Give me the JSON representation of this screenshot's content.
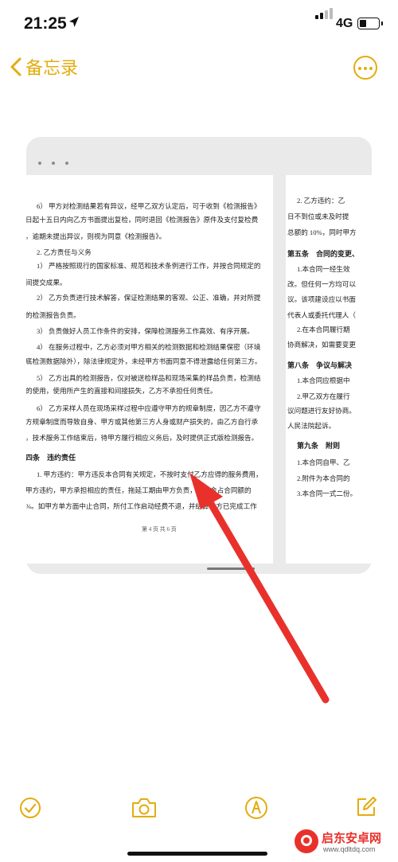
{
  "status_bar": {
    "time": "21:25",
    "network": "4G"
  },
  "nav": {
    "back_label": "备忘录"
  },
  "document": {
    "left_page_lines": [
      "6） 甲方对检测结果若有异议，经甲乙双方认定后，可于收到《检测报告》",
      "日起十五日内向乙方书面提出复检，同时退回《检测报告》原件及支付复检费",
      "。逾期未提出异议，则视为同意《检测报告》。",
      "2. 乙方责任与义务",
      "1） 严格按照现行的国家标准、规范和技术条例进行工作，并按合同规定的",
      "间提交成果。",
      "2） 乙方负责进行技术解答，保证检测结果的客观、公正、准确，并对所提",
      "的检测报告负责。",
      "3） 负责做好人员工作条件的安排，保障检测服务工作高效、有序开展。",
      "4） 在服务过程中，乙方必须对甲方相关的检测数据和检测结果保密（环境",
      "底检测数据除外），除法律规定外，未经甲方书面同意不得泄露给任何第三方。",
      "5） 乙方出具的检测报告，仅对被送检样品和现场采集的样品负责，检测结",
      "的使用，使用所产生的直接和间接损失，乙方不承担任何责任。",
      "6） 乙方采样人员在现场采样过程中应遵守甲方的规章制度，因乙方不遵守",
      "方规章制度而导致自身、甲方或其他第三方人身或财产损失的，由乙方自行承",
      "。技术服务工作结束后，待甲方履行相应义务后，及时提供正式版检测报告。",
      "四条　违约责任",
      "1. 甲方违约：甲方违反本合同有关规定，不按时支付乙方应得的服务费用，",
      "甲方违约，甲方承担相应的责任，拖延工期由甲方负责，违约金占合同额的",
      "%。如甲方单方面中止合同，所付工作启动经费不退，并结算乙方已完成工作"
    ],
    "left_page_footer": "第 4 页 共 6 页",
    "right_page_lines": [
      "2. 乙方违约：乙",
      "日不到位或未及时提",
      "总额的 10%，同时甲方",
      "第五条　合同的变更、",
      "1.本合同一经生效",
      "改。但任何一方均可以",
      "议。该项建设应以书面",
      "代表人或委托代理人（",
      "2.在本合同履行期",
      "协商解决，如需要变更",
      "第八条　争议与解决",
      "1.本合同应根据中",
      "2.甲乙双方在履行",
      "议问题进行友好协商。",
      "人民法院起诉。",
      "第九条　附则",
      "1.本合同自甲、乙",
      "2.附件为本合同的",
      "3.本合同一式二份。"
    ]
  },
  "toolbar": {
    "checklist": "checklist-icon",
    "camera": "camera-icon",
    "markup": "markup-pen-icon",
    "compose": "compose-icon"
  },
  "watermark": {
    "title": "启东安卓网",
    "url": "www.qdltdq.com"
  },
  "colors": {
    "accent": "#E3AC0F",
    "arrow": "#E9312B",
    "card_bg": "#EAEAEA"
  }
}
